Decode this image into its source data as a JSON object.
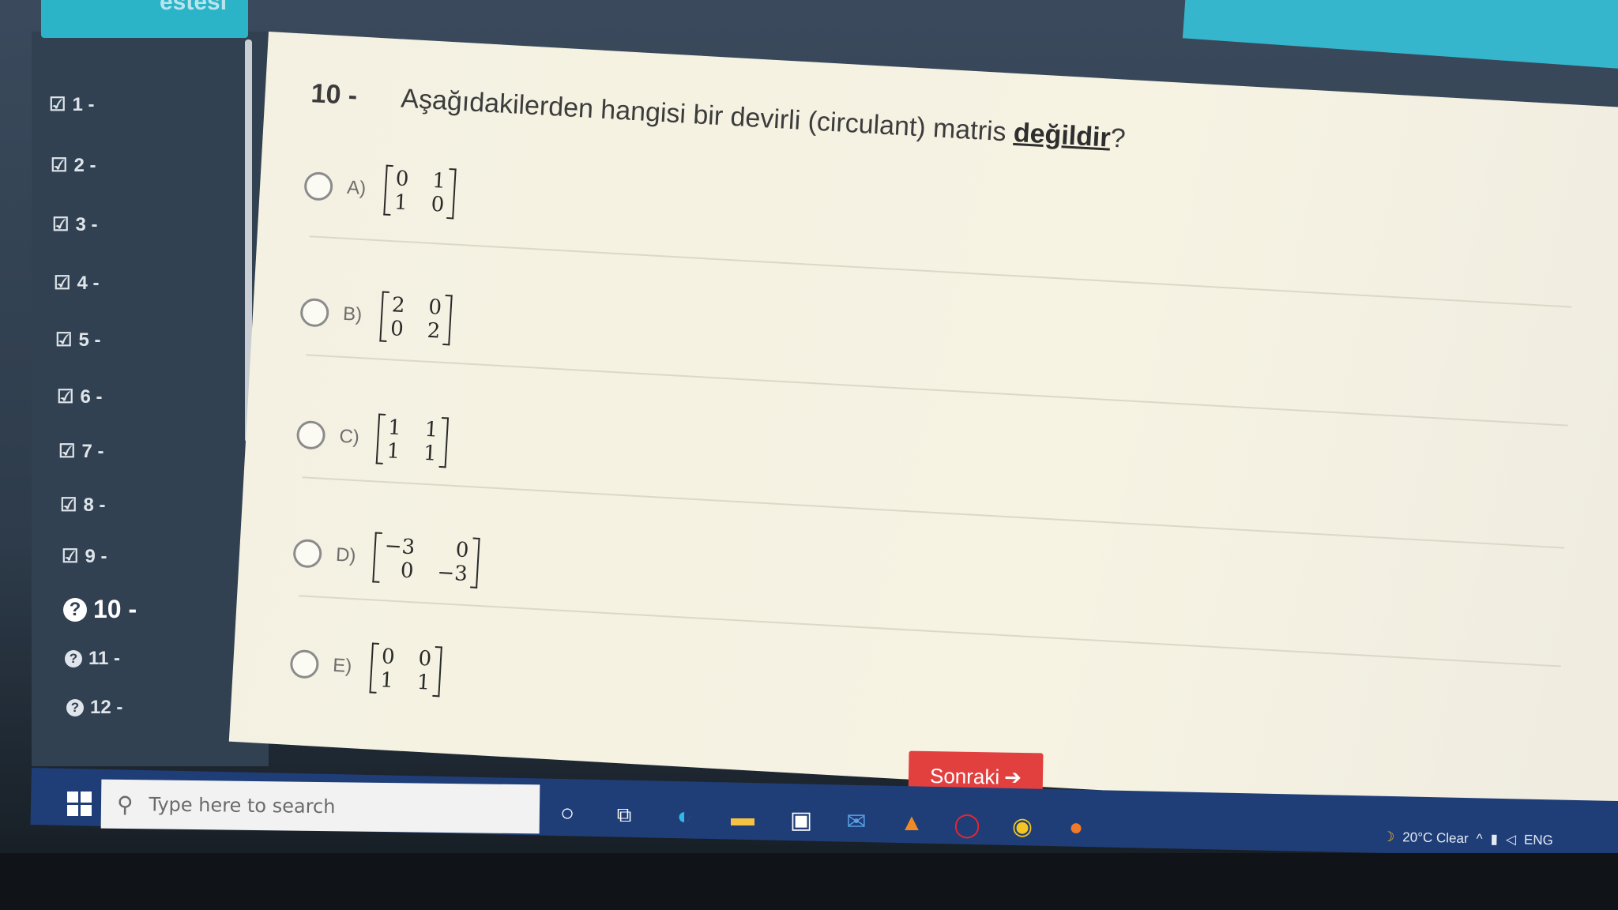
{
  "top_banner": {
    "text": "estesi"
  },
  "sidebar": {
    "items": [
      {
        "label": "1 -",
        "state": "answered",
        "icon": "check-square-icon"
      },
      {
        "label": "2 -",
        "state": "answered",
        "icon": "check-square-icon"
      },
      {
        "label": "3 -",
        "state": "answered",
        "icon": "check-square-icon"
      },
      {
        "label": "4 -",
        "state": "answered",
        "icon": "check-square-icon"
      },
      {
        "label": "5 -",
        "state": "answered",
        "icon": "check-square-icon"
      },
      {
        "label": "6 -",
        "state": "answered",
        "icon": "check-square-icon"
      },
      {
        "label": "7 -",
        "state": "answered",
        "icon": "check-square-icon"
      },
      {
        "label": "8 -",
        "state": "answered",
        "icon": "check-square-icon"
      },
      {
        "label": "9 -",
        "state": "answered",
        "icon": "check-square-icon"
      },
      {
        "label": "10 -",
        "state": "current",
        "icon": "question-circle-icon"
      },
      {
        "label": "11 -",
        "state": "unanswered",
        "icon": "question-circle-icon"
      },
      {
        "label": "12 -",
        "state": "unanswered",
        "icon": "question-circle-icon"
      }
    ]
  },
  "question": {
    "number": "10 -",
    "text_before": "Aşağıdakilerden hangisi bir devirli (circulant) matris ",
    "text_emph": "değildir",
    "text_after": "?",
    "options": [
      {
        "letter": "A)",
        "matrix": [
          [
            "0",
            "1"
          ],
          [
            "1",
            "0"
          ]
        ]
      },
      {
        "letter": "B)",
        "matrix": [
          [
            "2",
            "0"
          ],
          [
            "0",
            "2"
          ]
        ]
      },
      {
        "letter": "C)",
        "matrix": [
          [
            "1",
            "1"
          ],
          [
            "1",
            "1"
          ]
        ]
      },
      {
        "letter": "D)",
        "matrix": [
          [
            "−3",
            "0"
          ],
          [
            "0",
            "−3"
          ]
        ]
      },
      {
        "letter": "E)",
        "matrix": [
          [
            "0",
            "0"
          ],
          [
            "1",
            "1"
          ]
        ]
      }
    ]
  },
  "next_button": {
    "label": "Sonraki",
    "icon": "arrow-right-icon"
  },
  "taskbar": {
    "search_placeholder": "Type here to search",
    "weather": "20°C Clear",
    "language": "ENG",
    "accent": "#1f3e78"
  },
  "colors": {
    "sidebar": "#314152",
    "next_button": "#e2403f",
    "banner": "#2bb3c8"
  }
}
